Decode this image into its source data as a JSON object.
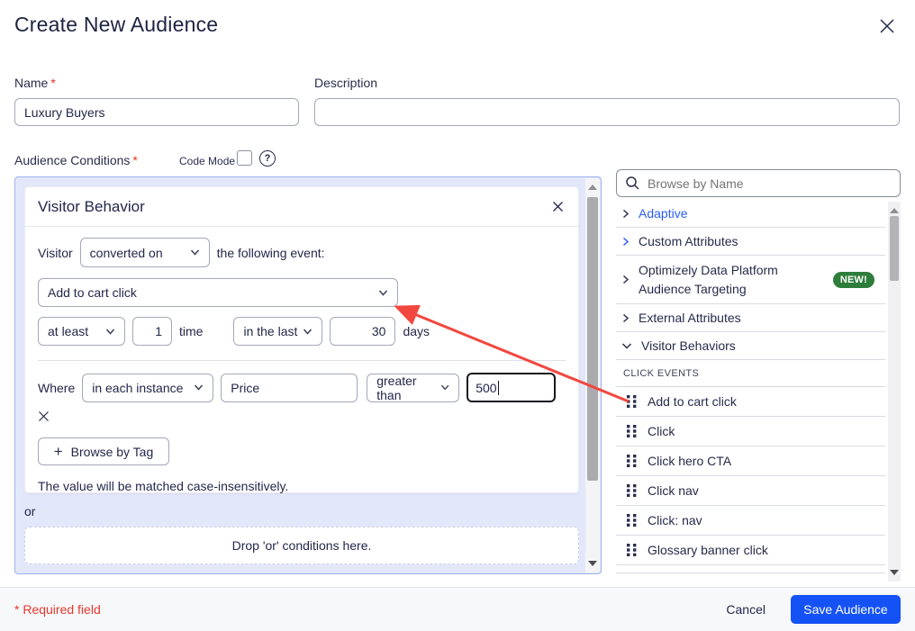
{
  "dialog": {
    "title": "Create New Audience"
  },
  "form": {
    "name": {
      "label": "Name",
      "required_mark": "*",
      "value": "Luxury Buyers"
    },
    "description": {
      "label": "Description",
      "value": ""
    },
    "conditions": {
      "label": "Audience Conditions",
      "required_mark": "*",
      "code_mode_label": "Code Mode",
      "help_glyph": "?"
    }
  },
  "condition_card": {
    "title": "Visitor Behavior",
    "visitor_label": "Visitor",
    "match_select_value": "converted on",
    "event_intro": "the following event:",
    "event_select_value": "Add to cart click",
    "frequency": {
      "qualifier_select_value": "at least",
      "count_value": "1",
      "time_label": "time",
      "window_select_value": "in the last",
      "window_value": "30",
      "days_label": "days"
    },
    "where": {
      "label": "Where",
      "scope_select_value": "in each instance",
      "field_value": "Price",
      "operator_select_value": "greater than",
      "value": "500"
    },
    "browse_by_tag": {
      "plus_glyph": "+",
      "label": "Browse by Tag"
    },
    "case_note": "The value will be matched case-insensitively.",
    "or_label": "or",
    "drop_hint": "Drop 'or' conditions here."
  },
  "sidebar": {
    "search_placeholder": "Browse by Name",
    "categories": [
      {
        "label": "Adaptive",
        "state": "collapsed",
        "highlighted": true
      },
      {
        "label": "Custom Attributes",
        "state": "collapsed"
      },
      {
        "label": "Optimizely Data Platform Audience Targeting",
        "state": "collapsed",
        "badge": "NEW!"
      },
      {
        "label": "External Attributes",
        "state": "collapsed"
      },
      {
        "label": "Visitor Behaviors",
        "state": "expanded"
      }
    ],
    "section_header": "CLICK EVENTS",
    "events": [
      "Add to cart click",
      "Click",
      "Click hero CTA",
      "Click nav",
      "Click: nav",
      "Glossary banner click"
    ]
  },
  "footer": {
    "required_note": "* Required field",
    "cancel_label": "Cancel",
    "save_label": "Save Audience"
  },
  "icons": {
    "dialog_close": "✕",
    "card_close": "✕",
    "remove_condition": "✕",
    "search": "magnifier",
    "help": "?",
    "chevron_collapsed": "›",
    "chevron_expanded": "⌄",
    "select_chevron": "⌄",
    "drag_handle": "⣿",
    "code_mode_checkbox": "unchecked"
  },
  "colors": {
    "accent_blue": "#1452f5",
    "link_blue": "#2a5cf5",
    "badge_green": "#2e7d3b",
    "arrow_red": "#f2473f",
    "required_red": "#e5372b",
    "panel_lavender": "#e3e7fa",
    "text_navy": "#23274a"
  }
}
